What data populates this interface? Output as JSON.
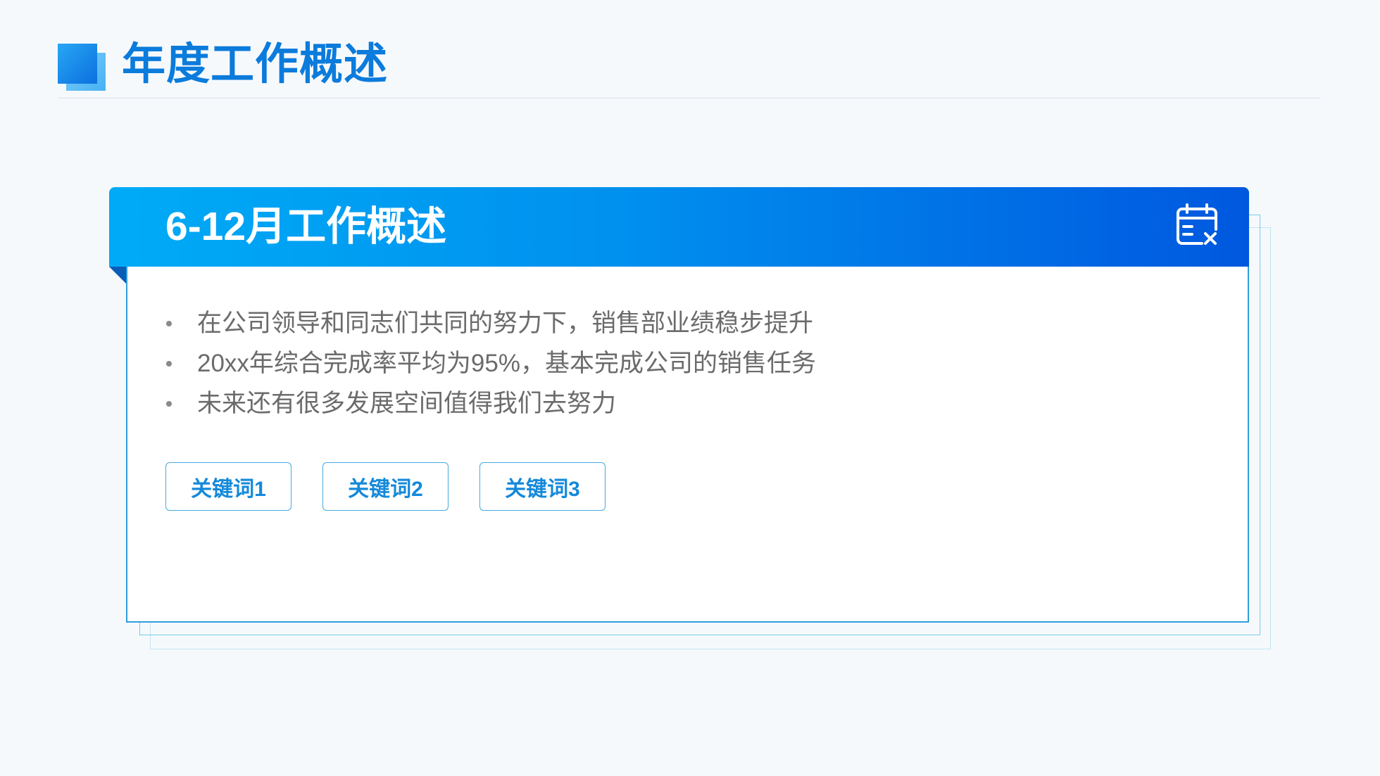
{
  "page": {
    "title": "年度工作概述",
    "title_icon": "square-logo-icon"
  },
  "card": {
    "header_title": "6-12月工作概述",
    "header_icon": "calendar-x-icon",
    "bullets": [
      "在公司领导和同志们共同的努力下，销售部业绩稳步提升",
      "20xx年综合完成率平均为95%，基本完成公司的销售任务",
      "未来还有很多发展空间值得我们去努力"
    ],
    "keywords": [
      "关键词1",
      "关键词2",
      "关键词3"
    ]
  },
  "colors": {
    "background": "#f6f9fc",
    "accent": "#0b7bdc",
    "header_gradient_start": "#00abf6",
    "header_gradient_end": "#0058df",
    "card_border": "#2f9fdc",
    "body_text": "#6b6b6b",
    "keyword_text": "#1489da"
  }
}
